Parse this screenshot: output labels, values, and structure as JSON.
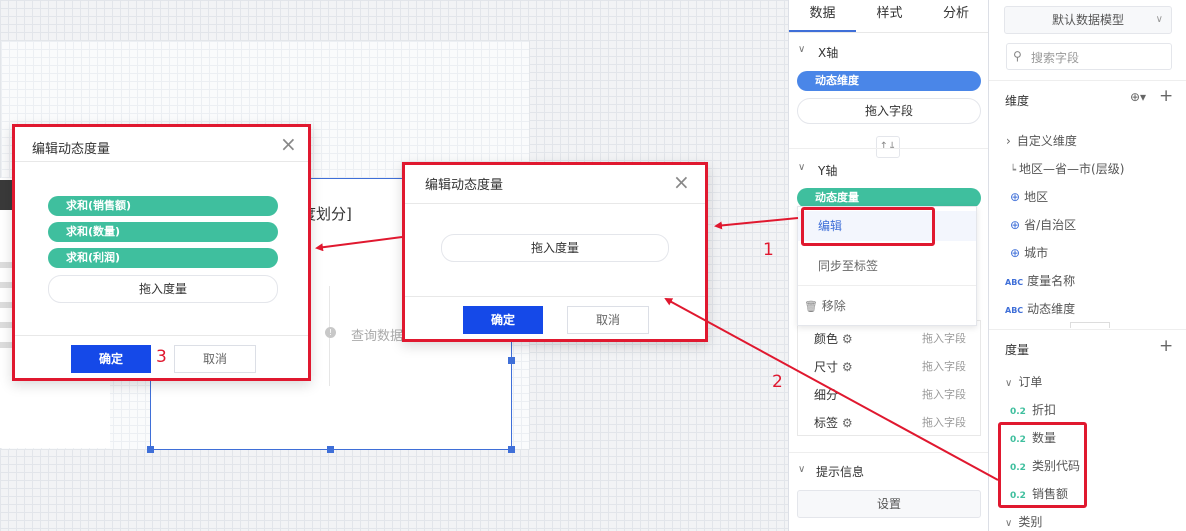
{
  "canvas": {
    "widget_text_fragment": "度划分]",
    "query_text": "查询数据"
  },
  "mid_panel": {
    "tabs": [
      "数据",
      "样式",
      "分析"
    ],
    "x_axis": {
      "title": "X轴",
      "pill": "动态维度",
      "drop": "拖入字段"
    },
    "y_axis": {
      "title": "Y轴",
      "pill": "动态度量"
    },
    "swap_icon": "↑↓",
    "context_menu": {
      "edit": "编辑",
      "sync": "同步至标签",
      "remove": "移除"
    },
    "props": [
      {
        "label": "颜色",
        "drop": "拖入字段"
      },
      {
        "label": "尺寸",
        "drop": "拖入字段"
      },
      {
        "label": "细分",
        "drop": "拖入字段"
      },
      {
        "label": "标签",
        "drop": "拖入字段"
      }
    ],
    "tooltip": {
      "title": "提示信息",
      "button": "设置"
    }
  },
  "right_panel": {
    "model_select": "默认数据模型",
    "search_placeholder": "搜索字段",
    "dimension_title": "维度",
    "dimensions": [
      {
        "icon": "chevron-right-icon",
        "label": "自定义维度"
      },
      {
        "icon": "hierarchy-icon",
        "label": "地区—省—市(层级)"
      },
      {
        "icon": "globe-icon",
        "label": "地区"
      },
      {
        "icon": "globe-icon",
        "label": "省/自治区"
      },
      {
        "icon": "globe-icon",
        "label": "城市"
      },
      {
        "icon": "abc-icon",
        "label": "度量名称"
      },
      {
        "icon": "abc-icon",
        "label": "动态维度"
      }
    ],
    "measure_title": "度量",
    "measure_groups": [
      {
        "label": "订单"
      },
      {
        "label": "类别"
      }
    ],
    "measures": [
      "折扣",
      "数量",
      "类别代码",
      "销售额"
    ],
    "measure_prefix": "0.2",
    "abc_prefix": "ABC"
  },
  "dialog_left": {
    "title": "编辑动态度量",
    "items": [
      "求和(销售额)",
      "求和(数量)",
      "求和(利润)"
    ],
    "drop": "拖入度量",
    "ok": "确定",
    "cancel": "取消"
  },
  "dialog_mid": {
    "title": "编辑动态度量",
    "drop": "拖入度量",
    "ok": "确定",
    "cancel": "取消"
  },
  "annotations": {
    "n1": "1",
    "n2": "2",
    "n3": "3"
  },
  "colors": {
    "accent_blue": "#4a86e8",
    "accent_green": "#3fbf9e",
    "annotation_red": "#e0182f",
    "button_blue": "#1549e8"
  }
}
